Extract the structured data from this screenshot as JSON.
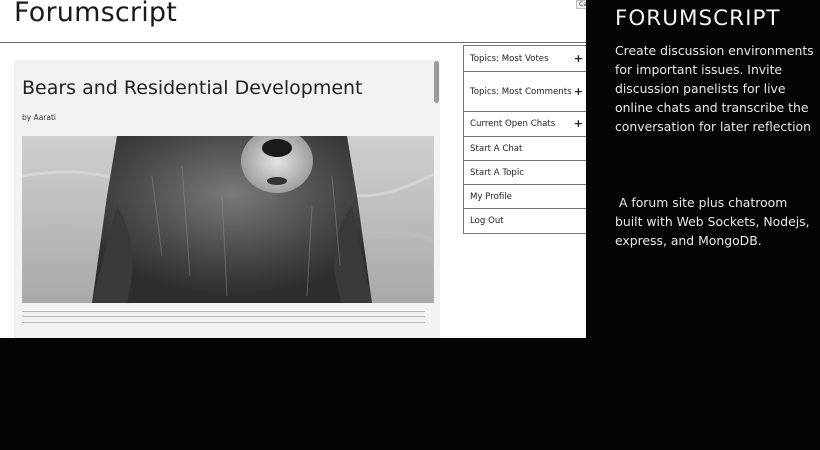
{
  "screenshot": {
    "site_title": "Forumscript",
    "corner_button": "Ca",
    "article": {
      "title": "Bears and Residential Development",
      "byline": "by Aarati",
      "image": "grizzly-bear-photo"
    },
    "menu": [
      {
        "label": "Topics: Most Votes",
        "expand": "+"
      },
      {
        "label": "Topics: Most Comments",
        "expand": "+"
      },
      {
        "label": "Current Open Chats",
        "expand": "+"
      },
      {
        "label": "Start A Chat"
      },
      {
        "label": "Start A Topic"
      },
      {
        "label": "My Profile"
      },
      {
        "label": "Log Out"
      }
    ]
  },
  "description": {
    "title": "FORUMSCRIPT",
    "paragraph1": "Create discussion environments for important issues. Invite discussion panelists for live online chats and transcribe the conversation for later reflection",
    "paragraph2": " A forum site plus chatroom built with Web Sockets, Nodejs, express, and MongoDB."
  },
  "colors": {
    "background": "#050505",
    "panel": "#ffffff",
    "text_light": "#e9e9e9"
  }
}
